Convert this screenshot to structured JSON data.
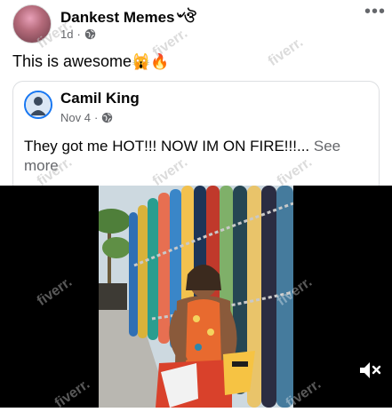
{
  "post": {
    "author": "Dankest Memes৺ঔ",
    "time": "1d",
    "privacy_icon": "globe-icon",
    "more_label": "•••",
    "text": "This is awesome",
    "emojis": [
      "🙀",
      "🔥"
    ]
  },
  "shared_post": {
    "author": "Camil King",
    "time": "Nov 4",
    "privacy_icon": "globe-icon",
    "text": "They got me HOT!!! NOW IM ON FIRE!!!...",
    "see_more": "See more"
  },
  "video": {
    "muted": true,
    "mute_icon": "speaker-muted-icon"
  },
  "watermark_text": "fiverr."
}
